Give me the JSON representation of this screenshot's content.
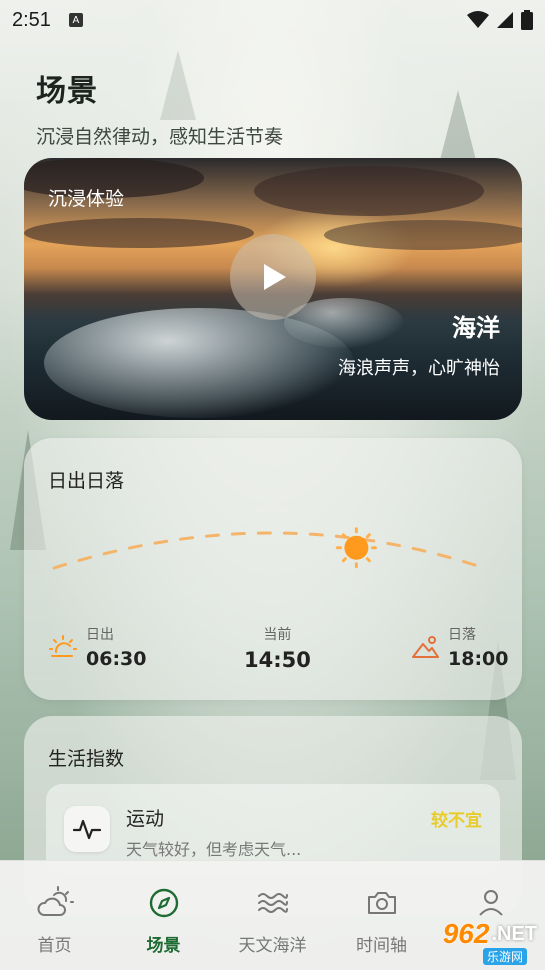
{
  "status_bar": {
    "time": "2:51",
    "notification_glyph": "A",
    "icons": [
      "wifi-icon",
      "signal-icon",
      "battery-icon"
    ]
  },
  "header": {
    "title": "场景",
    "subtitle": "沉浸自然律动，感知生活节奏"
  },
  "hero": {
    "tag": "沉浸体验",
    "title": "海洋",
    "description": "海浪声声，心旷神怡",
    "play_icon": "play-icon"
  },
  "sun_card": {
    "title": "日出日落",
    "sunrise": {
      "label": "日出",
      "value": "06:30",
      "icon": "sunrise-icon"
    },
    "current": {
      "label": "当前",
      "value": "14:50"
    },
    "sunset": {
      "label": "日落",
      "value": "18:00",
      "icon": "sunset-icon"
    },
    "sun_progress": 0.75,
    "accent": "#ff9a1e"
  },
  "life_card": {
    "title": "生活指数",
    "items": [
      {
        "name": "运动",
        "description": "天气较好，但考虑天气...",
        "level": "较不宜",
        "icon": "activity-icon",
        "level_color": "#e8cc2c"
      }
    ]
  },
  "tabs": [
    {
      "label": "首页",
      "icon": "weather-icon",
      "active": false
    },
    {
      "label": "场景",
      "icon": "compass-icon",
      "active": true
    },
    {
      "label": "天文海洋",
      "icon": "waves-icon",
      "active": false
    },
    {
      "label": "时间轴",
      "icon": "camera-icon",
      "active": false
    },
    {
      "label": "",
      "icon": "user-icon",
      "active": false
    }
  ],
  "colors": {
    "active_tab": "#1e6b33",
    "inactive_tab": "#777777"
  },
  "watermark": {
    "badge": "962",
    "text": ".NET",
    "sub": "乐游网"
  }
}
